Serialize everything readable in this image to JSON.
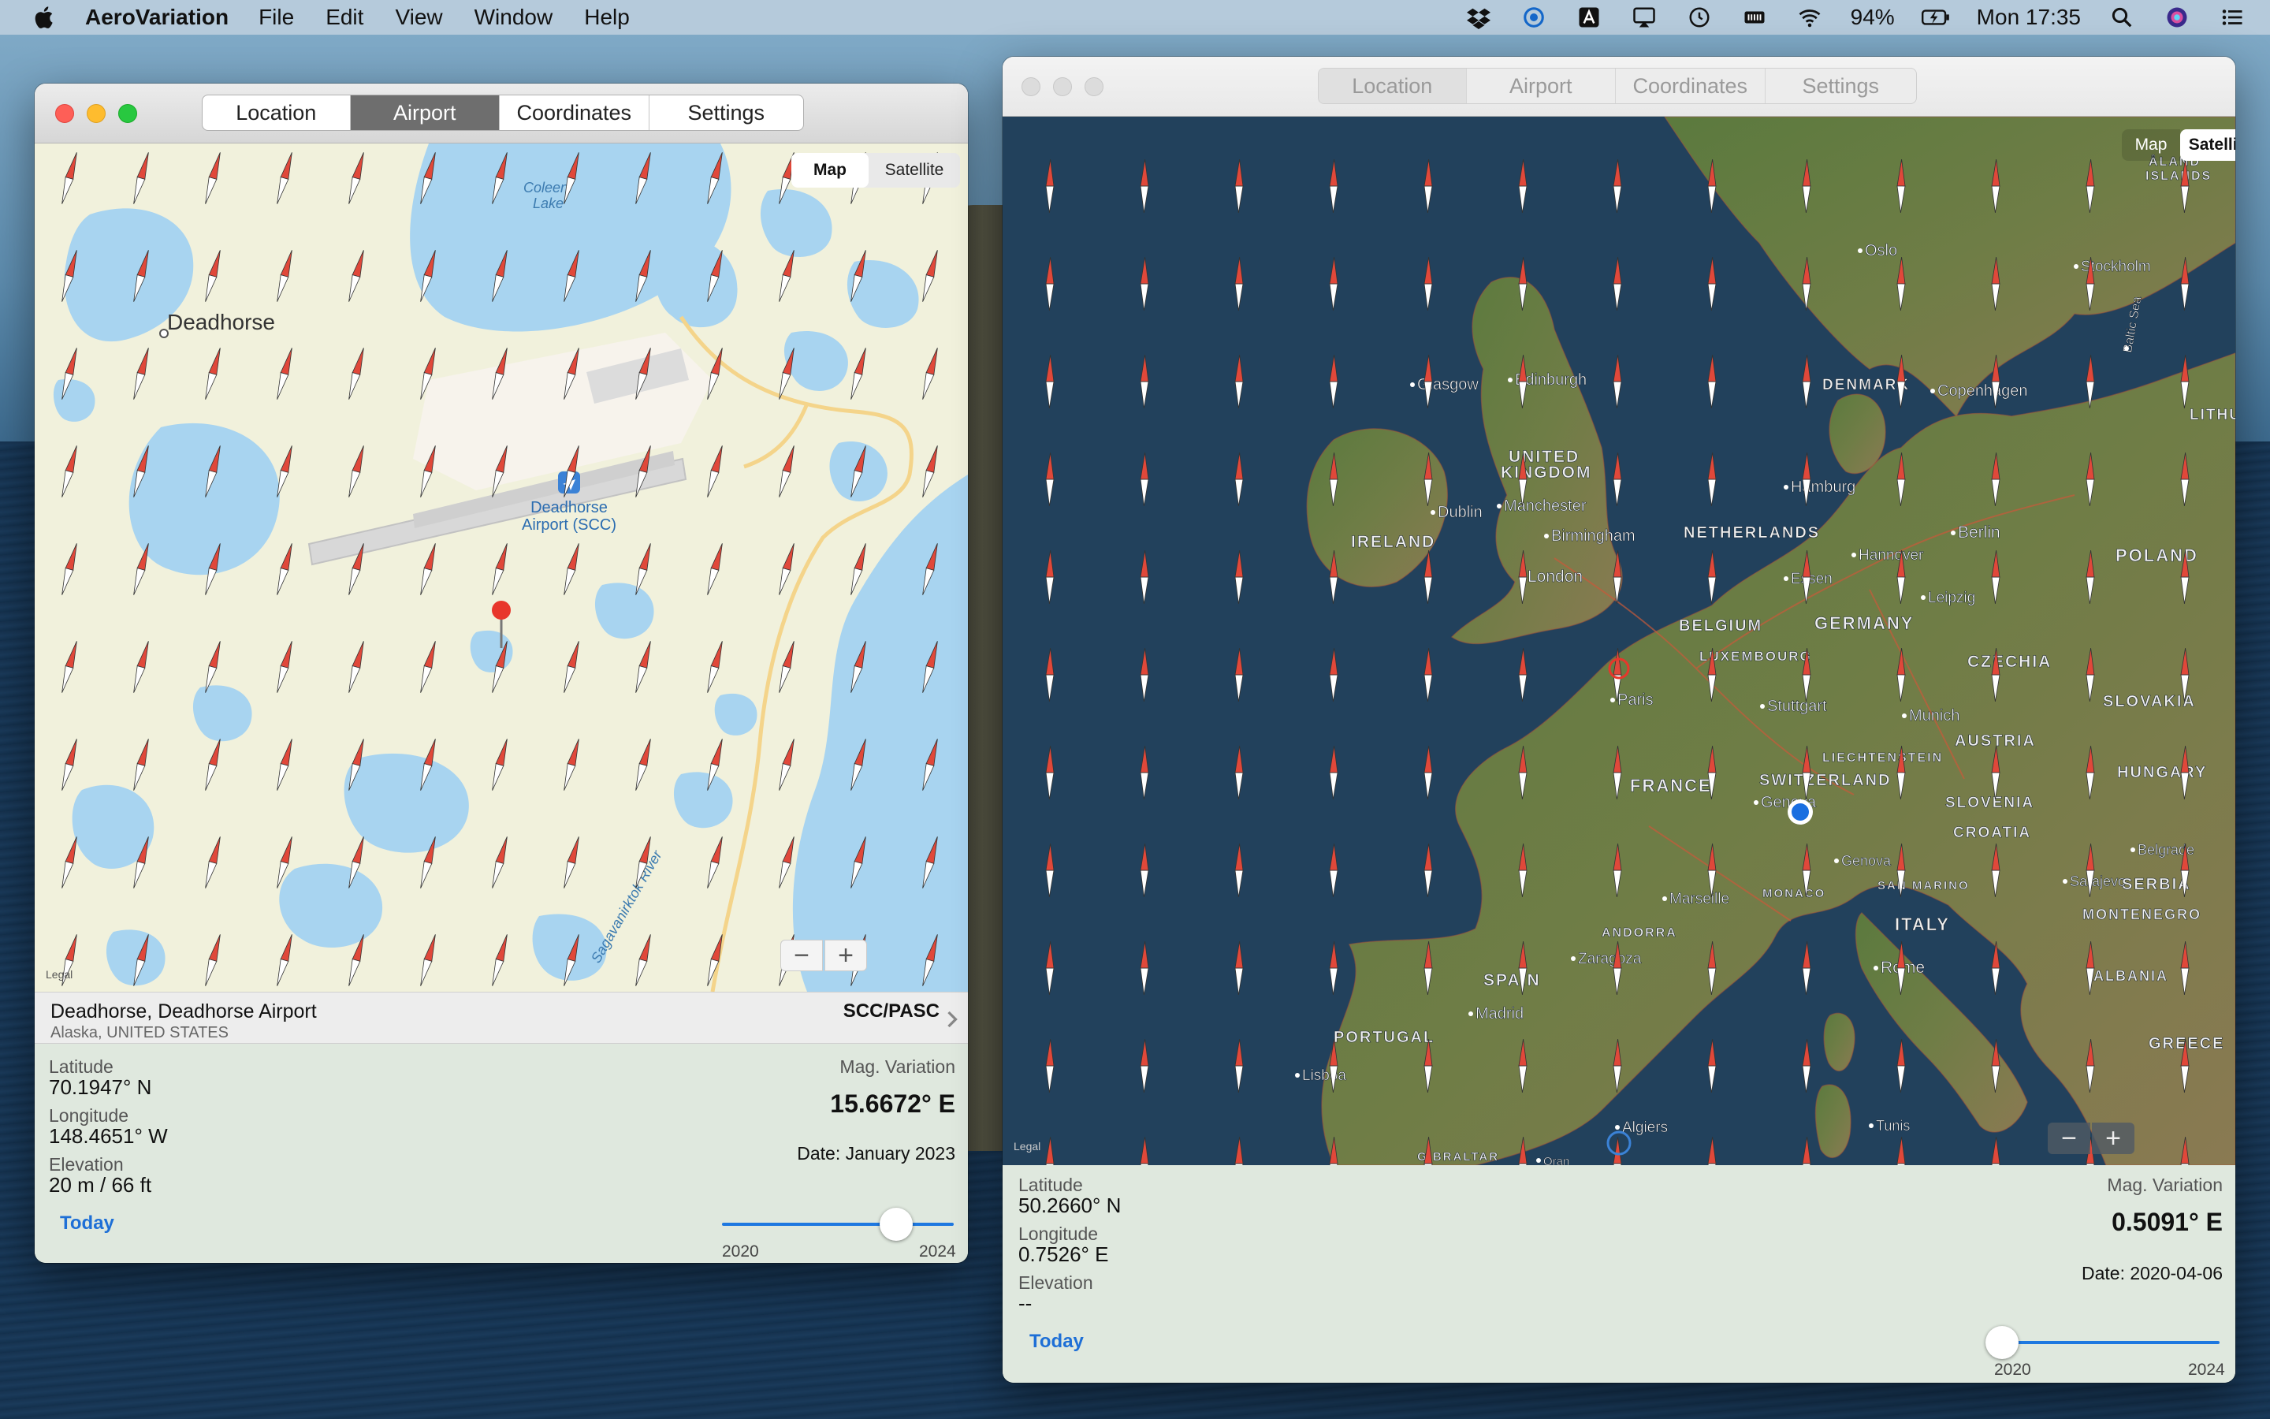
{
  "menubar": {
    "app_name": "AeroVariation",
    "menus": [
      "File",
      "Edit",
      "View",
      "Window",
      "Help"
    ],
    "battery": "94%",
    "clock": "Mon 17:35"
  },
  "window_left": {
    "tabs": [
      "Location",
      "Airport",
      "Coordinates",
      "Settings"
    ],
    "active_tab": "Airport",
    "map_toggle": {
      "map": "Map",
      "satellite": "Satellite",
      "selected": "Map"
    },
    "map_labels": {
      "town": "Deadhorse",
      "lake_line1": "Coleen",
      "lake_line2": "Lake",
      "airport_line1": "Deadhorse",
      "airport_line2": "Airport (SCC)",
      "river": "Sagavanirktok River"
    },
    "zoom": {
      "minus": "−",
      "plus": "+"
    },
    "legal": "Legal",
    "airport": {
      "name": "Deadhorse, Deadhorse Airport",
      "region": "Alaska, UNITED STATES",
      "code": "SCC/PASC"
    },
    "details": {
      "latitude_label": "Latitude",
      "latitude": "70.1947° N",
      "longitude_label": "Longitude",
      "longitude": "148.4651° W",
      "elevation_label": "Elevation",
      "elevation": "20 m / 66 ft",
      "variation_label": "Mag. Variation",
      "variation": "15.6672° E",
      "date": "Date: January 2023",
      "today": "Today",
      "slider_min": "2020",
      "slider_max": "2024",
      "slider_fraction": 0.75
    }
  },
  "window_right": {
    "tabs": [
      "Location",
      "Airport",
      "Coordinates",
      "Settings"
    ],
    "active_tab": "Location",
    "map_toggle": {
      "map": "Map",
      "satellite": "Satellite",
      "selected": "Satellite"
    },
    "map_labels": {
      "oslo": "Oslo",
      "aland": "ÅLAND",
      "islands": "ISLANDS",
      "stockholm": "Stockholm",
      "baltic": "Baltic Sea",
      "glasgow": "Glasgow",
      "edinburgh": "Edinburgh",
      "denmark": "DENMARK",
      "copenhagen": "Copenhagen",
      "lithu": "LITHU",
      "united": "UNITED",
      "kingdom": "KINGDOM",
      "hamburg": "Hamburg",
      "dublin": "Dublin",
      "manchester": "Manchester",
      "ireland": "IRELAND",
      "birmingham": "Birmingham",
      "netherlands": "NETHERLANDS",
      "hannover": "Hannover",
      "berlin": "Berlin",
      "poland": "POLAND",
      "london": "London",
      "essen": "Essen",
      "leipzig": "Leipzig",
      "belgium": "BELGIUM",
      "germany": "GERMANY",
      "luxembourg": "LUXEMBOURG",
      "czechia": "CZECHIA",
      "paris": "Paris",
      "stuttgart": "Stuttgart",
      "munich": "Munich",
      "slovakia": "SLOVAKIA",
      "liechtenstein": "LIECHTENSTEIN",
      "austria": "AUSTRIA",
      "france": "FRANCE",
      "switzerland": "SWITZERLAND",
      "hungary": "HUNGARY",
      "geneva": "Geneva",
      "slovenia": "SLOVENIA",
      "croatia": "CROATIA",
      "belgrade": "Belgrade",
      "genova": "Genova",
      "marseille": "Marseille",
      "san_marino": "SAN MARINO",
      "sarajevo": "Sarajevo",
      "serbia": "SERBIA",
      "monaco": "MONACO",
      "andorra": "ANDORRA",
      "italy": "ITALY",
      "montenegro": "MONTENEGRO",
      "zaragoza": "Zaragoza",
      "rome": "Rome",
      "spain": "SPAIN",
      "albania": "ALBANIA",
      "madrid": "Madrid",
      "portugal": "PORTUGAL",
      "greece": "GREECE",
      "lisboa": "Lisboa",
      "algiers": "Algiers",
      "tunis": "Tunis",
      "gibraltar": "GIBRALTAR",
      "oran": "Oran"
    },
    "zoom": {
      "minus": "−",
      "plus": "+"
    },
    "legal": "Legal",
    "details": {
      "latitude_label": "Latitude",
      "latitude": "50.2660° N",
      "longitude_label": "Longitude",
      "longitude": "0.7526° E",
      "elevation_label": "Elevation",
      "elevation": "--",
      "variation_label": "Mag. Variation",
      "variation": "0.5091° E",
      "date": "Date: 2020-04-06",
      "today": "Today",
      "slider_min": "2020",
      "slider_max": "2024",
      "slider_fraction": 0.0
    }
  },
  "colors": {
    "accent": "#1e6fd6",
    "needle_north": "#e0483a",
    "needle_south": "#ffffff",
    "water_map": "#a8d4f0",
    "land_map": "#f1f1dc"
  }
}
